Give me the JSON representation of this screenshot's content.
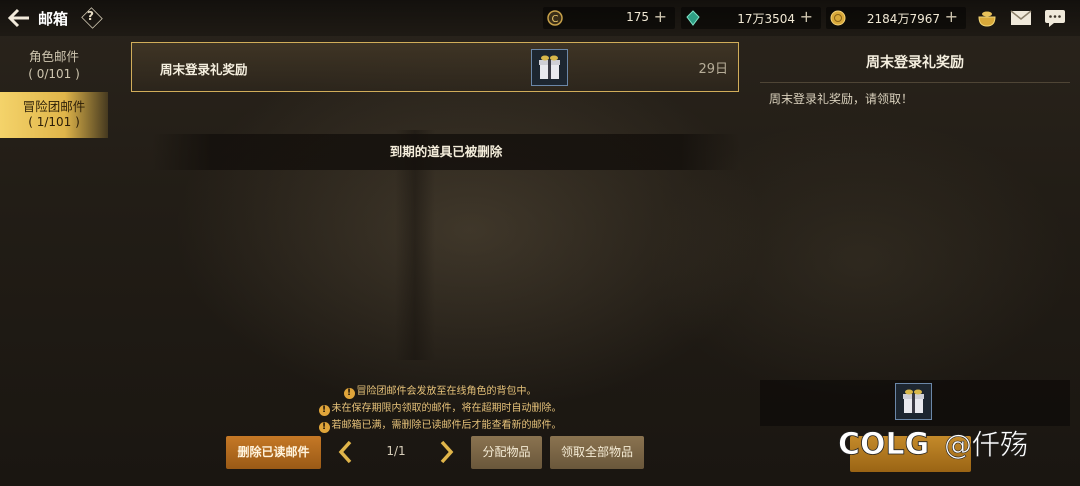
{
  "header": {
    "title": "邮箱",
    "help_label": "?"
  },
  "currencies": [
    {
      "icon": "c-coin-icon",
      "value": "175",
      "color": "#c9a24a"
    },
    {
      "icon": "green-crystal-icon",
      "value": "17万3504",
      "color": "#46c2a0"
    },
    {
      "icon": "gold-coin-icon",
      "value": "2184万7967",
      "color": "#d9a93a"
    }
  ],
  "top_icons": [
    "treasure-pot-icon",
    "mail-envelope-icon",
    "chat-icon"
  ],
  "tabs": [
    {
      "label": "角色邮件",
      "count": "( 0/101 )",
      "active": false
    },
    {
      "label": "冒险团邮件",
      "count": "( 1/101 )",
      "active": true
    }
  ],
  "mail_list": [
    {
      "subject": "周末登录礼奖励",
      "item_icon": "gift-box-icon",
      "days_left": "29日"
    }
  ],
  "expired_notice": "到期的道具已被删除",
  "detail": {
    "title": "周末登录礼奖励",
    "body": "周末登录礼奖励，请领取！",
    "attachment_icon": "gift-box-icon"
  },
  "notices": [
    "冒险团邮件会发放至在线角色的背包中。",
    "未在保存期限内领取的邮件，将在超期时自动删除。",
    "若邮箱已满，需删除已读邮件后才能查看新的邮件。"
  ],
  "controls": {
    "delete_read": "删除已读邮件",
    "page": "1/1",
    "distribute": "分配物品",
    "claim_all": "领取全部物品"
  },
  "watermark": "COLG @仟殇"
}
